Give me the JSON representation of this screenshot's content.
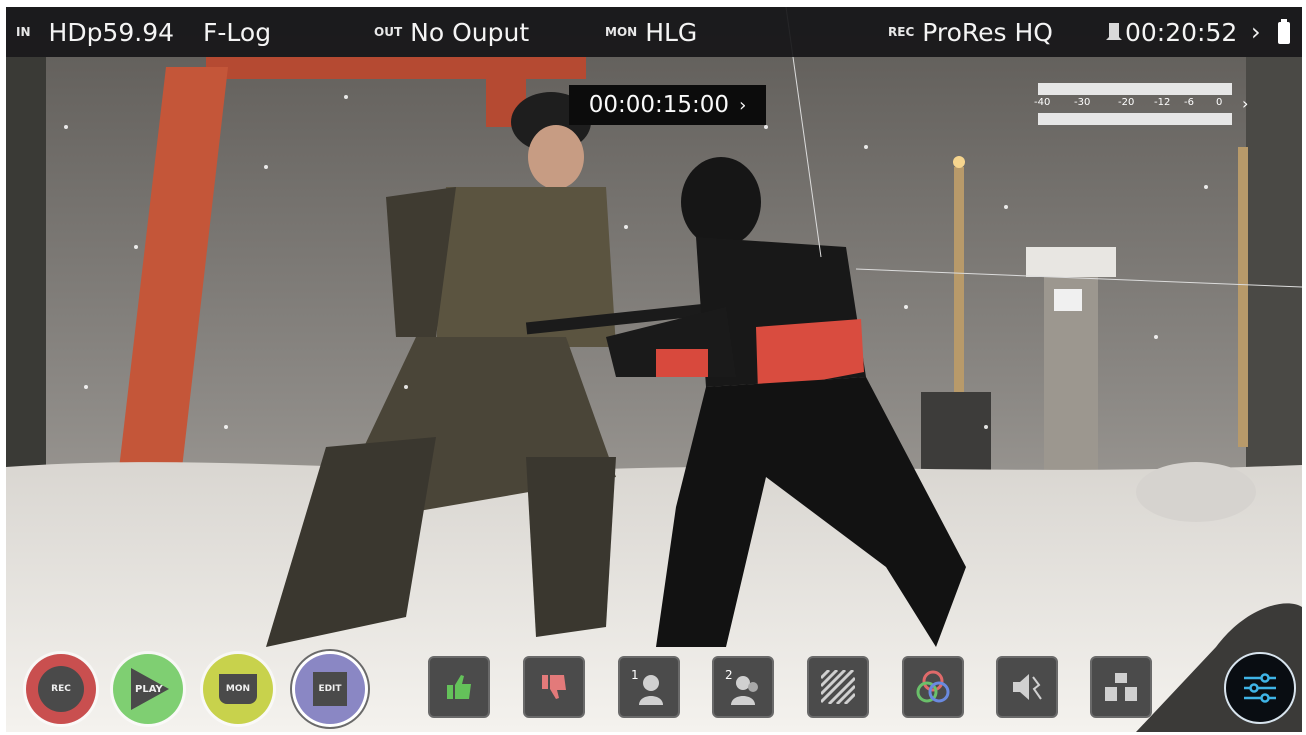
{
  "status_bar": {
    "in_label": "IN",
    "in_format": "HDp59.94",
    "in_gamma": "F-Log",
    "out_label": "OUT",
    "out_value": "No Ouput",
    "mon_label": "MON",
    "mon_value": "HLG",
    "rec_label": "REC",
    "rec_codec": "ProRes HQ",
    "remaining_time": "00:20:52",
    "chevron": "›"
  },
  "timecode": {
    "value": "00:00:15:00",
    "chevron": "›"
  },
  "audio_meter": {
    "scale": [
      "-40",
      "-30",
      "-20",
      "-12",
      "-6",
      "0"
    ],
    "chevron": "›"
  },
  "mode_buttons": [
    {
      "label": "REC",
      "color": "#c94f4f"
    },
    {
      "label": "PLAY",
      "color": "#7fcf72"
    },
    {
      "label": "MON",
      "color": "#c8d24c"
    },
    {
      "label": "EDIT",
      "color": "#8a87c4"
    }
  ],
  "tool_buttons": [
    {
      "icon": "thumbs-up-icon",
      "color": "#64c25a"
    },
    {
      "icon": "thumbs-down-icon",
      "color": "#e37a7a"
    },
    {
      "icon": "single-person-icon",
      "label": "1"
    },
    {
      "icon": "two-shot-icon",
      "label": "2"
    },
    {
      "icon": "zebra-icon"
    },
    {
      "icon": "false-color-icon"
    },
    {
      "icon": "speaker-mute-icon"
    },
    {
      "icon": "frame-guides-icon"
    }
  ],
  "settings_button": {
    "icon": "sliders-icon",
    "color": "#3fb4e6"
  }
}
